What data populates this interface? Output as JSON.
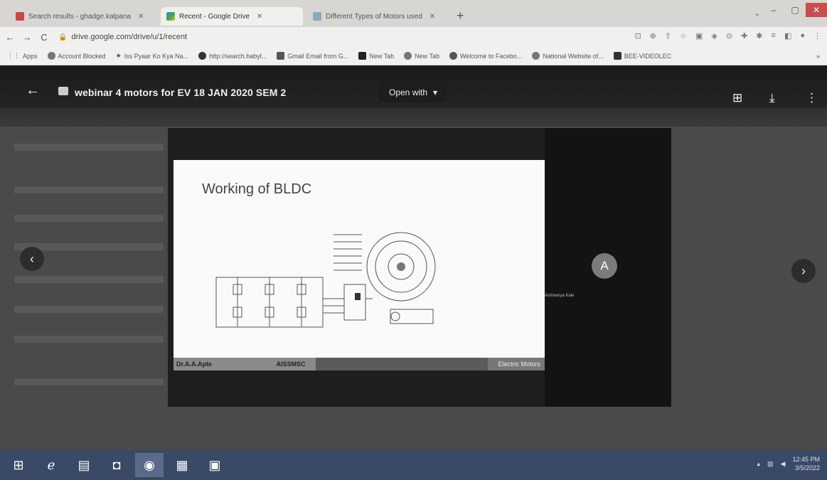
{
  "tabs": [
    {
      "label": "Search results - ghadge.kalpana",
      "close": "✕"
    },
    {
      "label": "Recent - Google Drive",
      "close": "✕"
    },
    {
      "label": "Different Types of Motors used",
      "close": "✕"
    }
  ],
  "new_tab": "+",
  "window_controls": {
    "minimize": "–",
    "maximize": "▢",
    "close": "✕"
  },
  "tab_search": "⌄",
  "address_bar": {
    "url": "drive.google.com/drive/u/1/recent"
  },
  "nav": {
    "back": "←",
    "forward": "→",
    "reload": "C"
  },
  "bookmarks": [
    "Apps",
    "Account Blocked",
    "Iss Pyaar Ko Kya Na...",
    "http://search.babyl...",
    "Gmail Email from G...",
    "New Tab",
    "New Tab",
    "Welcome to Facebo...",
    "National Website of...",
    "BEE-VIDEOLEC"
  ],
  "bookmarks_more": "»",
  "viewer": {
    "back": "←",
    "file_title": "webinar 4 motors for EV 18 JAN 2020 SEM 2",
    "open_with": "Open with",
    "open_with_caret": "▾",
    "add_icon": "⊞",
    "download_icon": "⤓",
    "more_icon": "⋮",
    "prev": "‹",
    "next": "›"
  },
  "slide": {
    "title": "Working of BLDC",
    "footer_author": "Dr.A.A.Apte",
    "footer_org": "AISSMSC",
    "footer_topic": "Electric Motors"
  },
  "participant": {
    "initial": "A",
    "name": "Aishwarya Kale"
  },
  "taskbar": {
    "apps": [
      "start",
      "internet-explorer",
      "file-explorer",
      "store",
      "chrome",
      "reader",
      "media"
    ],
    "time": "12:45 PM",
    "date": "3/5/2022"
  }
}
